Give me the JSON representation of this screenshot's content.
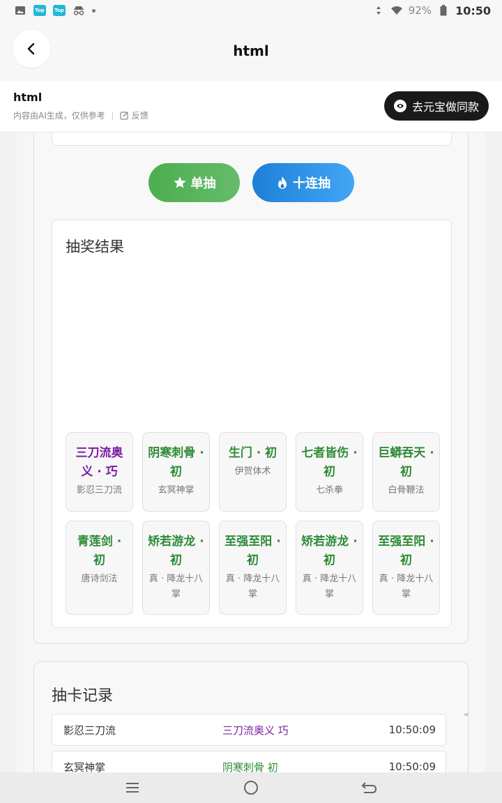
{
  "status": {
    "battery": "92%",
    "time": "10:50"
  },
  "header": {
    "title": "html"
  },
  "info": {
    "title": "html",
    "disclaimer": "内容由AI生成，仅供参考",
    "feedback": "反馈",
    "yuanbao_button": "去元宝做同款"
  },
  "actions": {
    "single": "单抽",
    "ten": "十连抽"
  },
  "result": {
    "title": "抽奖结果",
    "items": [
      {
        "name": "三刀流奥义 · 巧",
        "skill": "影忍三刀流",
        "color": "purple"
      },
      {
        "name": "阴寒刺骨 · 初",
        "skill": "玄冥神掌",
        "color": "green"
      },
      {
        "name": "生门 · 初",
        "skill": "伊贺体术",
        "color": "green"
      },
      {
        "name": "七者皆伤 · 初",
        "skill": "七杀拳",
        "color": "green"
      },
      {
        "name": "巨蟒吞天 · 初",
        "skill": "白骨鞭法",
        "color": "green"
      },
      {
        "name": "青莲剑 · 初",
        "skill": "唐诗剑法",
        "color": "green"
      },
      {
        "name": "矫若游龙 · 初",
        "skill": "真 · 降龙十八掌",
        "color": "green"
      },
      {
        "name": "至强至阳 · 初",
        "skill": "真 · 降龙十八掌",
        "color": "green"
      },
      {
        "name": "矫若游龙 · 初",
        "skill": "真 · 降龙十八掌",
        "color": "green"
      },
      {
        "name": "至强至阳 · 初",
        "skill": "真 · 降龙十八掌",
        "color": "green"
      }
    ]
  },
  "records": {
    "title": "抽卡记录",
    "rows": [
      {
        "source": "影忍三刀流",
        "item": "三刀流奥义 巧",
        "time": "10:50:09",
        "color": "purple"
      },
      {
        "source": "玄冥神掌",
        "item": "阴寒刺骨 初",
        "time": "10:50:09",
        "color": "green"
      }
    ]
  },
  "colors": {
    "purple": "#7b1fa2",
    "green": "#2e8b37",
    "single_button": "#4cae4f",
    "ten_button": "#1e7fd8"
  }
}
